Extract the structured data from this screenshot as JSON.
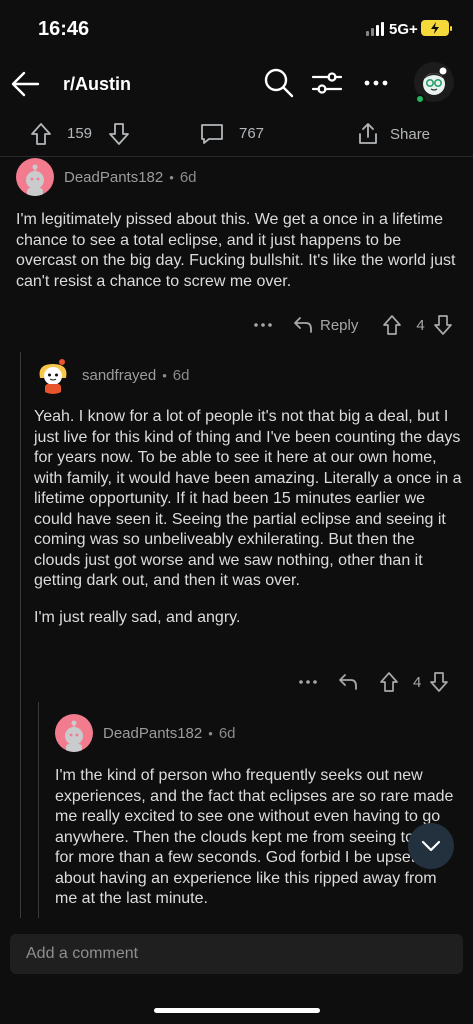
{
  "status": {
    "time": "16:46",
    "network": "5G+"
  },
  "header": {
    "title": "r/Austin"
  },
  "post_actions": {
    "upvotes": "159",
    "comments": "767",
    "share_label": "Share"
  },
  "comments": [
    {
      "author": "DeadPants182",
      "sep": "•",
      "age": "6d",
      "body": [
        "I'm legitimately pissed about this. We get a once in a lifetime chance to see a total eclipse, and it just happens to be overcast on the big day. Fucking bullshit. It's like the world just can't resist a chance to screw me over."
      ],
      "reply_label": "Reply",
      "score": "4",
      "avatar_color": "#f27c8e"
    },
    {
      "author": "sandfrayed",
      "sep": "•",
      "age": "6d",
      "body": [
        "Yeah.  I know for a lot of people it's not that big a deal, but I just live for this kind of thing and I've been counting the days for years now.  To be able to see it here at our own home, with family, it would have been amazing.  Literally a once in a lifetime opportunity.  If it had been 15 minutes earlier we could have seen it.  Seeing the partial eclipse and seeing it coming was so unbeliveably exhilerating.  But then the clouds just got worse and we saw nothing, other than it getting dark out, and then it was over.",
        "I'm just really sad, and angry."
      ],
      "score": "4",
      "avatar_color": "#f7c64a"
    },
    {
      "author": "DeadPants182",
      "sep": "•",
      "age": "6d",
      "body": [
        "I'm the kind of person who frequently seeks out new experiences, and the fact that eclipses are so rare made me really excited to see one without even having to go anywhere. Then the clouds kept me from seeing totality for more than a few seconds. God forbid I be upset about having an experience like this ripped away from me at the last minute."
      ],
      "avatar_color": "#f27c8e"
    }
  ],
  "composer": {
    "placeholder": "Add a comment"
  },
  "colors": {
    "accent": "#1fb85a",
    "fab": "#23313f",
    "battery": "#f5d83a"
  }
}
